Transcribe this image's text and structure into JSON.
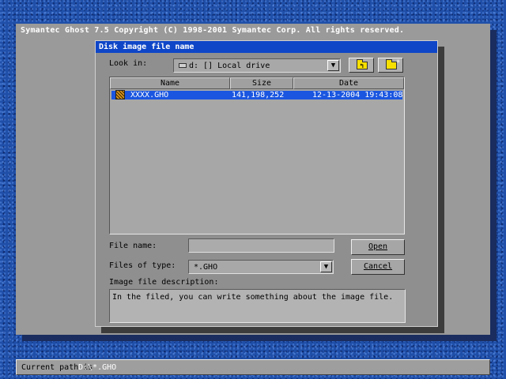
{
  "app": {
    "title": "Symantec Ghost 7.5   Copyright (C) 1998-2001 Symantec Corp. All rights reserved."
  },
  "dialog": {
    "title": "Disk image file name",
    "look_in_label": "Look in:",
    "look_in_value": "d: [] Local drive",
    "columns": {
      "name": "Name",
      "size": "Size",
      "date": "Date"
    },
    "files": [
      {
        "name": "XXXX.GHO",
        "size": "141,198,252",
        "date": "12-13-2004 19:43:08",
        "icon": "ghost-image-icon",
        "selected": true
      }
    ],
    "file_name_label": "File name:",
    "file_name_value": "",
    "files_of_type_label": "Files of type:",
    "files_of_type_value": "*.GHO",
    "open_button": "Open",
    "cancel_button": "Cancel",
    "description_label": "Image file description:",
    "description_value": "In the filed, you can write something about the image file.",
    "icons": {
      "up_folder": "up-folder-icon",
      "new_folder": "new-folder-icon",
      "drive": "drive-icon",
      "dropdown": "dropdown-arrow-icon"
    }
  },
  "status": {
    "label": "Current path is",
    "value": "D:\\*.GHO"
  },
  "colors": {
    "desktop": "#1f4fa8",
    "window": "#9a9a9a",
    "dialog_title": "#0f46c8",
    "selection": "#1a56e0"
  }
}
